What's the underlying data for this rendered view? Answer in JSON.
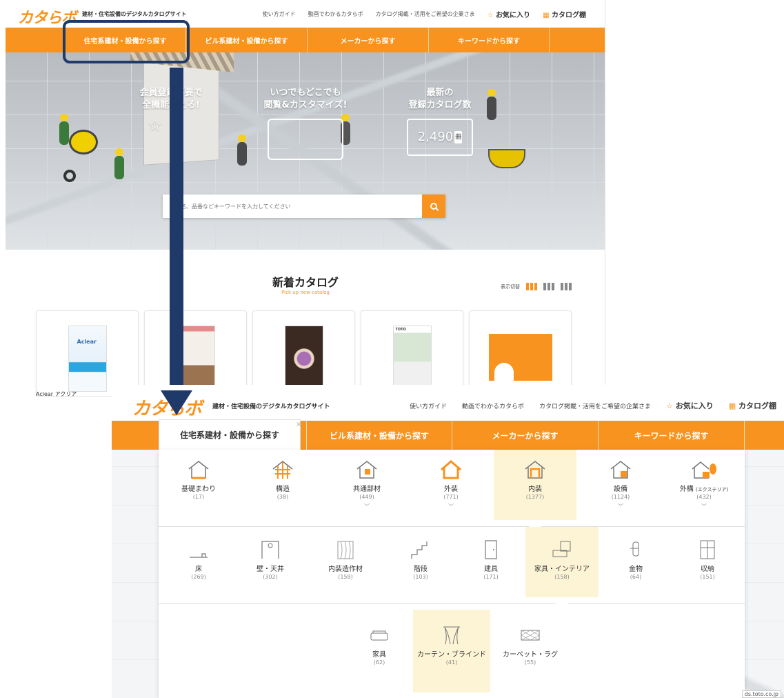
{
  "top": {
    "logo": "カタらボ",
    "tagline": "建材・住宅設備のデジタルカタログサイト",
    "header_links": [
      "使い方ガイド",
      "動画でわかるカタらボ",
      "カタログ掲載・活用をご希望の企業さま"
    ],
    "favorites": "お気に入り",
    "catalog_shelf": "カタログ棚",
    "nav": [
      "住宅系建材・設備から探す",
      "ビル系建材・設備から探す",
      "メーカーから探す",
      "キーワードから探す"
    ],
    "hero": {
      "feature1_line1": "会員登録不要で",
      "feature1_line2": "全機能使える!",
      "feature2_line1": "いつでもどこでも",
      "feature2_line2": "閲覧&カスタマイズ!",
      "feature3_line1": "最新の",
      "feature3_line2": "登録カタログ数",
      "catalog_count": "2,490",
      "count_unit": "冊"
    },
    "search_placeholder": "名、品番などキーワードを入力してください",
    "new_title": "新着カタログ",
    "new_subtitle": "Pick up new catalog",
    "view_switch": "表示切替",
    "first_card_caption": "Aclear アクリア",
    "cover_texts": [
      "Aclear",
      "TOTO"
    ]
  },
  "bottom": {
    "logo": "カタらボ",
    "tagline": "建材・住宅設備のデジタルカタログサイト",
    "header_links": [
      "使い方ガイド",
      "動画でわかるカタらボ",
      "カタログ掲載・活用をご希望の企業さま"
    ],
    "favorites": "お気に入り",
    "catalog_shelf": "カタログ棚",
    "close": "×",
    "nav": [
      "住宅系建材・設備から探す",
      "ビル系建材・設備から探す",
      "メーカーから探す",
      "キーワードから探す"
    ],
    "categories": [
      {
        "label": "基礎まわり",
        "count": "(17)"
      },
      {
        "label": "構造",
        "count": "(38)"
      },
      {
        "label": "共通部材",
        "count": "(449)"
      },
      {
        "label": "外装",
        "count": "(771)"
      },
      {
        "label": "内装",
        "count": "(1377)"
      },
      {
        "label": "設備",
        "count": "(1124)"
      },
      {
        "label": "外構",
        "label_suffix": "(エクステリア)",
        "count": "(432)"
      }
    ],
    "subcategories": [
      {
        "label": "床",
        "count": "(269)"
      },
      {
        "label": "壁・天井",
        "count": "(302)"
      },
      {
        "label": "内装造作材",
        "count": "(159)"
      },
      {
        "label": "階段",
        "count": "(103)"
      },
      {
        "label": "建具",
        "count": "(171)"
      },
      {
        "label": "家具・インテリア",
        "count": "(158)"
      },
      {
        "label": "金物",
        "count": "(64)"
      },
      {
        "label": "収納",
        "count": "(151)"
      }
    ],
    "items": [
      {
        "label": "家具",
        "count": "(62)"
      },
      {
        "label": "カーテン・ブラインド",
        "count": "(41)"
      },
      {
        "label": "カーペット・ラグ",
        "count": "(55)"
      }
    ],
    "corner_url": "ds.toto.co.jp"
  },
  "colors": {
    "accent": "#f7931e",
    "annotation": "#1f3a68",
    "selected_bg": "#fdf4d6"
  }
}
